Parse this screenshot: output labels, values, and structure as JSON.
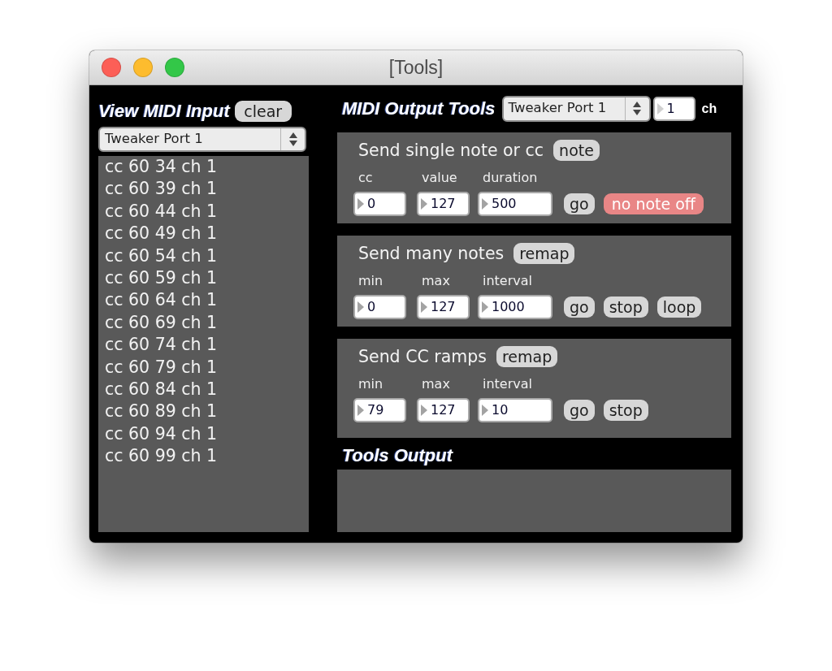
{
  "window": {
    "title": "[Tools]"
  },
  "midi_input": {
    "heading": "View MIDI Input",
    "clear_button": "clear",
    "port": "Tweaker Port 1",
    "messages": [
      "cc 60 34 ch 1",
      "cc 60 39 ch 1",
      "cc 60 44 ch 1",
      "cc 60 49 ch 1",
      "cc 60 54 ch 1",
      "cc 60 59 ch 1",
      "cc 60 64 ch 1",
      "cc 60 69 ch 1",
      "cc 60 74 ch 1",
      "cc 60 79 ch 1",
      "cc 60 84 ch 1",
      "cc 60 89 ch 1",
      "cc 60 94 ch 1",
      "cc 60 99 ch 1"
    ]
  },
  "midi_output": {
    "heading": "MIDI Output Tools",
    "port": "Tweaker Port 1",
    "channel": "1",
    "channel_label": "ch"
  },
  "sections": [
    {
      "title": "Send single note or cc",
      "mode_button": "note",
      "fields": [
        {
          "label": "cc",
          "value": "0"
        },
        {
          "label": "value",
          "value": "127"
        },
        {
          "label": "duration",
          "value": "500"
        }
      ],
      "buttons": [
        {
          "label": "go",
          "on": false
        },
        {
          "label": "no note off",
          "on": true
        }
      ]
    },
    {
      "title": "Send many notes",
      "mode_button": "remap",
      "fields": [
        {
          "label": "min",
          "value": "0"
        },
        {
          "label": "max",
          "value": "127"
        },
        {
          "label": "interval",
          "value": "1000"
        }
      ],
      "buttons": [
        {
          "label": "go",
          "on": false
        },
        {
          "label": "stop",
          "on": false
        },
        {
          "label": "loop",
          "on": false
        }
      ]
    },
    {
      "title": "Send CC ramps",
      "mode_button": "remap",
      "fields": [
        {
          "label": "min",
          "value": "79"
        },
        {
          "label": "max",
          "value": "127"
        },
        {
          "label": "interval",
          "value": "10"
        }
      ],
      "buttons": [
        {
          "label": "go",
          "on": false
        },
        {
          "label": "stop",
          "on": false
        }
      ]
    }
  ],
  "tools_output": {
    "heading": "Tools Output"
  }
}
